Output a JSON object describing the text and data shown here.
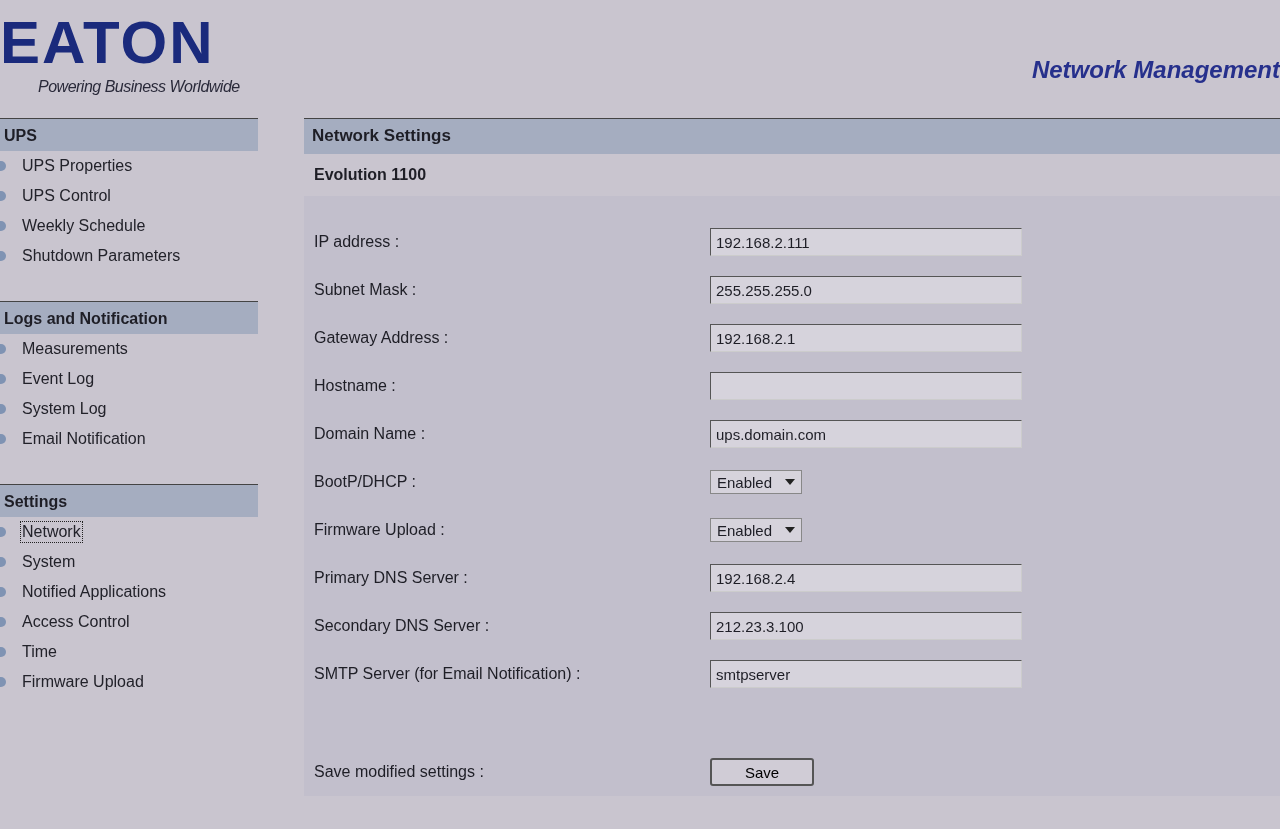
{
  "header": {
    "logo": "EATON",
    "tagline": "Powering Business Worldwide",
    "title": "Network Management"
  },
  "sidebar": [
    {
      "title": "UPS",
      "items": [
        {
          "label": "UPS Properties",
          "selected": false
        },
        {
          "label": "UPS Control",
          "selected": false
        },
        {
          "label": "Weekly Schedule",
          "selected": false
        },
        {
          "label": "Shutdown Parameters",
          "selected": false
        }
      ]
    },
    {
      "title": "Logs and Notification",
      "items": [
        {
          "label": "Measurements",
          "selected": false
        },
        {
          "label": "Event Log",
          "selected": false
        },
        {
          "label": "System Log",
          "selected": false
        },
        {
          "label": "Email Notification",
          "selected": false
        }
      ]
    },
    {
      "title": "Settings",
      "items": [
        {
          "label": "Network",
          "selected": true
        },
        {
          "label": "System",
          "selected": false
        },
        {
          "label": "Notified Applications",
          "selected": false
        },
        {
          "label": "Access Control",
          "selected": false
        },
        {
          "label": "Time",
          "selected": false
        },
        {
          "label": "Firmware Upload",
          "selected": false
        }
      ]
    }
  ],
  "panel": {
    "title": "Network Settings",
    "device": "Evolution 1100",
    "fields": [
      {
        "kind": "text",
        "label": "IP address :",
        "value": "192.168.2.111"
      },
      {
        "kind": "text",
        "label": "Subnet Mask :",
        "value": "255.255.255.0"
      },
      {
        "kind": "text",
        "label": "Gateway Address :",
        "value": "192.168.2.1"
      },
      {
        "kind": "text",
        "label": "Hostname :"
      },
      {
        "kind": "text",
        "label": "Domain Name :",
        "value": "ups.domain.com"
      },
      {
        "kind": "select",
        "label": "BootP/DHCP :",
        "value": "Enabled"
      },
      {
        "kind": "select",
        "label": "Firmware Upload :",
        "value": "Enabled"
      },
      {
        "kind": "text",
        "label": "Primary DNS Server :",
        "value": "192.168.2.4"
      },
      {
        "kind": "text",
        "label": "Secondary DNS Server :",
        "value": "212.23.3.100"
      },
      {
        "kind": "text",
        "label": "SMTP Server (for Email Notification) :",
        "value": "smtpserver"
      }
    ],
    "save_label": "Save modified settings :",
    "save_button": "Save"
  }
}
